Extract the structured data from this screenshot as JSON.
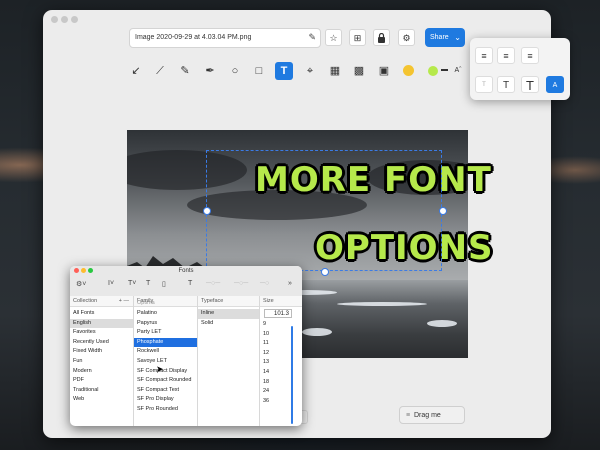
{
  "window": {
    "filename": "Image 2020-09-29 at 4.03.04 PM.png",
    "share_label": "Share"
  },
  "toolbar_icons": [
    "arrow-tool-icon",
    "line-tool-icon",
    "pen-tool-icon",
    "highlighter-tool-icon",
    "ellipse-tool-icon",
    "rectangle-tool-icon",
    "text-tool-icon",
    "crop-tool-icon",
    "pixelate-tool-icon",
    "blur-tool-icon",
    "fill-tool-icon",
    "emoji-tool-icon",
    "color-swatch-icon",
    "stroke-width-icon",
    "font-size-icon"
  ],
  "header_icons": [
    "star-icon",
    "save-to-icon",
    "lock-icon",
    "settings-icon"
  ],
  "canvas": {
    "line1": "MORE FONT",
    "line2": "OPTIONS"
  },
  "drag_me_label": "Drag me",
  "text_popover": {
    "style_letters": [
      "T",
      "T",
      "T",
      "A"
    ]
  },
  "fonts_panel": {
    "title": "Fonts",
    "headers": {
      "collection": "Collection",
      "family": "Family",
      "typeface": "Typeface",
      "size": "Size"
    },
    "collections": [
      "All Fonts",
      "English",
      "Favorites",
      "Recently Used",
      "Fixed Width",
      "Fun",
      "Modern",
      "PDF",
      "Traditional",
      "Web"
    ],
    "selected_collection": "English",
    "families": [
      "Optima",
      "Palatino",
      "Papyrus",
      "Party LET",
      "Phosphate",
      "Rockwell",
      "Savoye LET",
      "SF Compact Display",
      "SF Compact Rounded",
      "SF Compact Text",
      "SF Pro Display",
      "SF Pro Rounded"
    ],
    "selected_family": "Phosphate",
    "typefaces": [
      "Inline",
      "Solid"
    ],
    "selected_typeface": "Inline",
    "size_value": "101.3",
    "sizes": [
      "9",
      "10",
      "11",
      "12",
      "13",
      "14",
      "18",
      "24",
      "36"
    ]
  },
  "colors": {
    "accent": "#1f7ae0",
    "text_fill": "#b6e94b",
    "text_outline": "#000000"
  }
}
